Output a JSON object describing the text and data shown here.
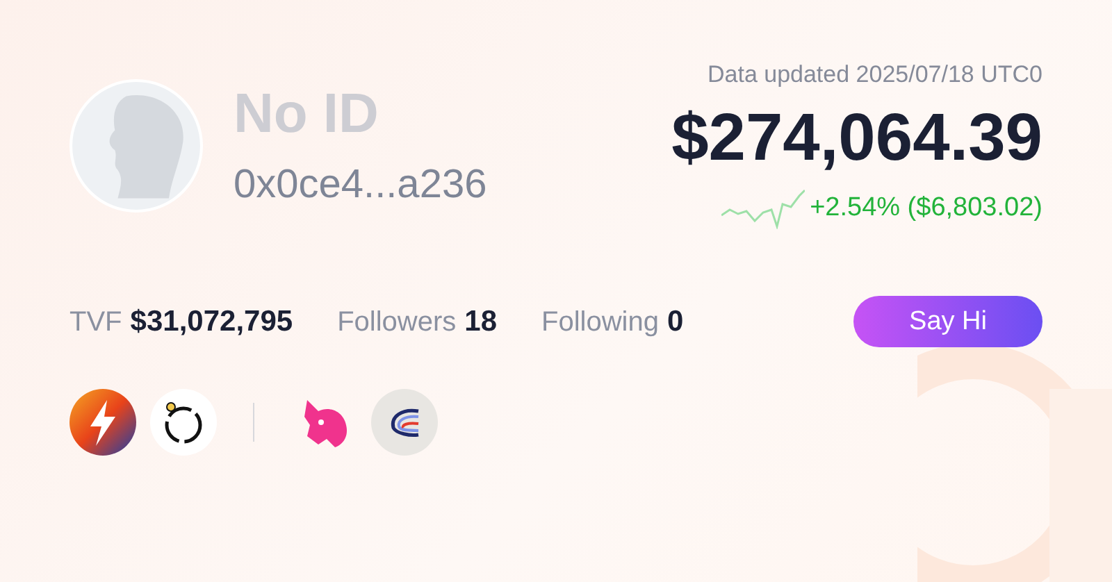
{
  "profile": {
    "name": "No ID",
    "address": "0x0ce4...a236"
  },
  "portfolio": {
    "updated": "Data updated 2025/07/18 UTC0",
    "value": "$274,064.39",
    "change": "+2.54% ($6,803.02)"
  },
  "stats": [
    {
      "label": "TVF",
      "value": "$31,072,795"
    },
    {
      "label": "Followers",
      "value": "18"
    },
    {
      "label": "Following",
      "value": "0"
    }
  ],
  "button": "Say Hi"
}
